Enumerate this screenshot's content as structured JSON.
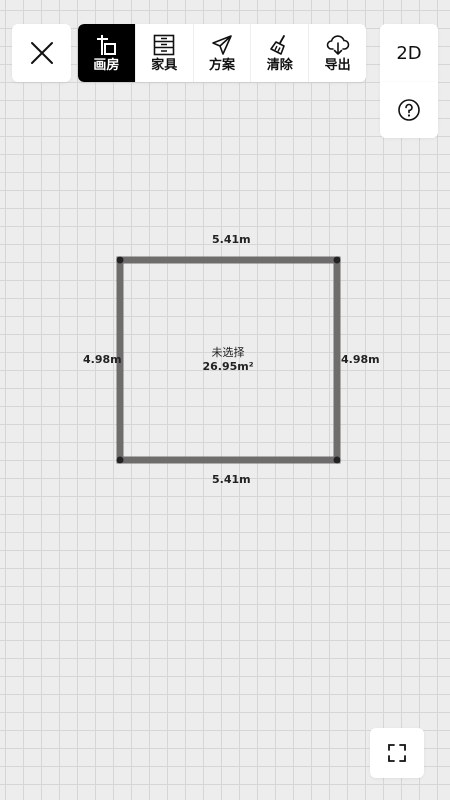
{
  "view_toggle": "2D",
  "toolbar": {
    "items": [
      {
        "label": "画房",
        "icon": "draw-room-icon",
        "active": true
      },
      {
        "label": "家具",
        "icon": "furniture-cabinet-icon",
        "active": false
      },
      {
        "label": "方案",
        "icon": "paper-plane-icon",
        "active": false
      },
      {
        "label": "清除",
        "icon": "broom-icon",
        "active": false
      },
      {
        "label": "导出",
        "icon": "cloud-download-icon",
        "active": false
      }
    ]
  },
  "room": {
    "name": "未选择",
    "area": "26.95m²",
    "dims": {
      "top": "5.41m",
      "bottom": "5.41m",
      "left": "4.98m",
      "right": "4.98m"
    }
  },
  "colors": {
    "background": "#ededed",
    "grid": "#d6d6d6",
    "wall": "#6f6c6c",
    "active_tab": "#000000"
  }
}
